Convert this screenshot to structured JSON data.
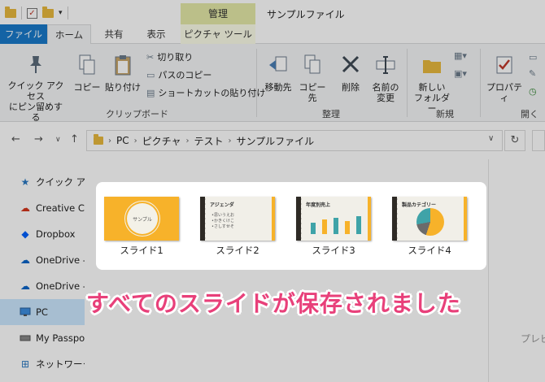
{
  "window": {
    "context_tab": "管理",
    "title": "サンプルファイル"
  },
  "tabs": {
    "file": "ファイル",
    "home": "ホーム",
    "share": "共有",
    "view": "表示",
    "picture_tools": "ピクチャ ツール"
  },
  "ribbon": {
    "quick_access_line1": "クイック アクセス",
    "quick_access_line2": "にピン留めする",
    "copy": "コピー",
    "paste": "貼り付け",
    "cut": "切り取り",
    "copy_path": "パスのコピー",
    "paste_shortcut": "ショートカットの貼り付け",
    "clipboard_group": "クリップボード",
    "move_to": "移動先",
    "copy_to": "コピー先",
    "delete": "削除",
    "rename_line1": "名前の",
    "rename_line2": "変更",
    "organize_group": "整理",
    "new_folder_line1": "新しい",
    "new_folder_line2": "フォルダー",
    "new_group": "新規",
    "properties": "プロパティ",
    "open_group": "開く"
  },
  "address": {
    "crumbs": [
      "PC",
      "ピクチャ",
      "テスト",
      "サンプルファイル"
    ]
  },
  "sidebar": {
    "items": [
      {
        "label": "クイック アクセス",
        "icon": "star-icon"
      },
      {
        "label": "Creative Cloud Files",
        "icon": "creative-cloud-icon"
      },
      {
        "label": "Dropbox",
        "icon": "dropbox-icon"
      },
      {
        "label": "OneDrive - ",
        "icon": "onedrive-icon"
      },
      {
        "label": "OneDrive - ",
        "icon": "onedrive-icon"
      },
      {
        "label": "PC",
        "icon": "pc-icon"
      },
      {
        "label": "My Passport",
        "icon": "drive-icon"
      },
      {
        "label": "ネットワーク",
        "icon": "network-icon"
      }
    ]
  },
  "files": [
    {
      "name": "スライド1",
      "seal_text": "サンプル"
    },
    {
      "name": "スライド2",
      "title": "アジェンダ",
      "lines": [
        "•思いうえお",
        "•かきくけこ",
        "•さしすせそ"
      ]
    },
    {
      "name": "スライド3",
      "title": "年度別売上"
    },
    {
      "name": "スライド4",
      "title": "製品カテゴリー"
    }
  ],
  "preview_label": "プレビュー",
  "caption": "すべてのスライドが保存されました",
  "colors": {
    "accent_orange": "#f7b22a",
    "dark_edge": "#2e2a25",
    "teal": "#3fa3a8",
    "caption_pink": "#e8407a",
    "file_tab_blue": "#1979ca"
  }
}
